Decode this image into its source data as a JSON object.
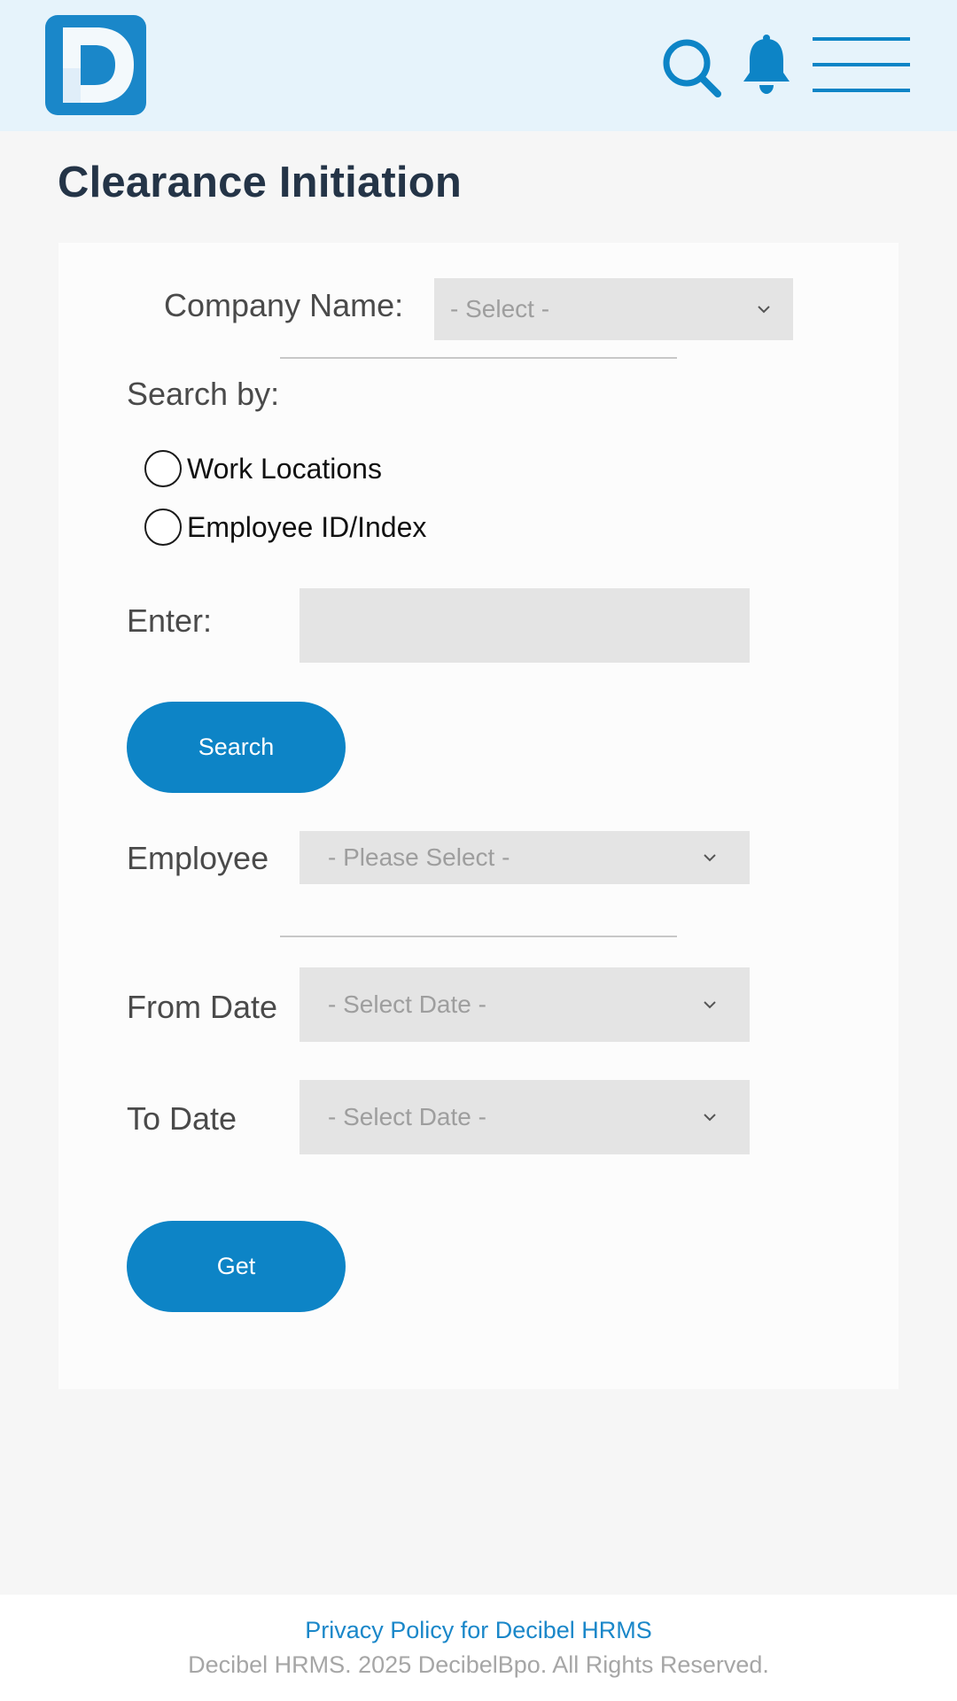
{
  "header": {
    "logo_icon": "decibel-d-logo",
    "search_icon": "search-icon",
    "notification_icon": "bell-icon",
    "menu_icon": "hamburger-menu-icon",
    "accent_color": "#0d84c6"
  },
  "page": {
    "title": "Clearance Initiation"
  },
  "form": {
    "company_label": "Company Name:",
    "company_select_placeholder": "- Select -",
    "search_by_label": "Search by:",
    "search_options": [
      "Work Locations",
      "Employee ID/Index"
    ],
    "enter_label": "Enter:",
    "enter_value": "",
    "search_button": "Search",
    "employee_label": "Employee",
    "employee_select_placeholder": "- Please Select -",
    "from_date_label": "From Date",
    "from_date_placeholder": "- Select Date -",
    "to_date_label": "To Date",
    "to_date_placeholder": "- Select Date -",
    "get_button": "Get"
  },
  "footer": {
    "privacy_link": "Privacy Policy for Decibel HRMS",
    "copyright": "Decibel HRMS. 2025 DecibelBpo. All Rights Reserved."
  }
}
